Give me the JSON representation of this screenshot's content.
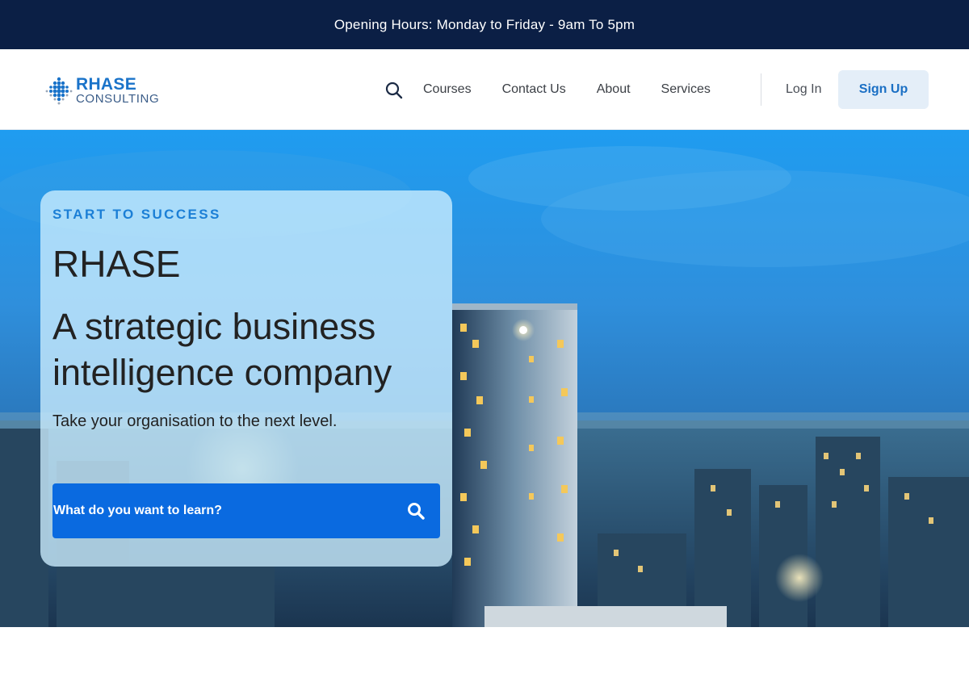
{
  "topbar": {
    "text": "Opening Hours: Monday to Friday - 9am To 5pm"
  },
  "header": {
    "logo": {
      "line1": "RHASE",
      "line2": "CONSULTING",
      "icon": "dot-grid-logo-icon"
    },
    "search_icon": "search-icon",
    "nav": [
      {
        "label": "Courses"
      },
      {
        "label": "Contact Us"
      },
      {
        "label": "About"
      },
      {
        "label": "Services"
      }
    ],
    "login_label": "Log In",
    "signup_label": "Sign Up"
  },
  "hero": {
    "eyebrow": "START TO SUCCESS",
    "brand": "RHASE",
    "headline": "A strategic business intelligence company",
    "tagline": "Take your organisation to the next level.",
    "search": {
      "placeholder": "What do you want to learn?",
      "icon": "search-icon"
    },
    "background": "city-skyline-dusk-image"
  },
  "colors": {
    "topbar_bg": "#0b1f45",
    "accent": "#1a73c9",
    "search_bar": "#0a6ae0",
    "signup_bg": "#e4eef8"
  }
}
